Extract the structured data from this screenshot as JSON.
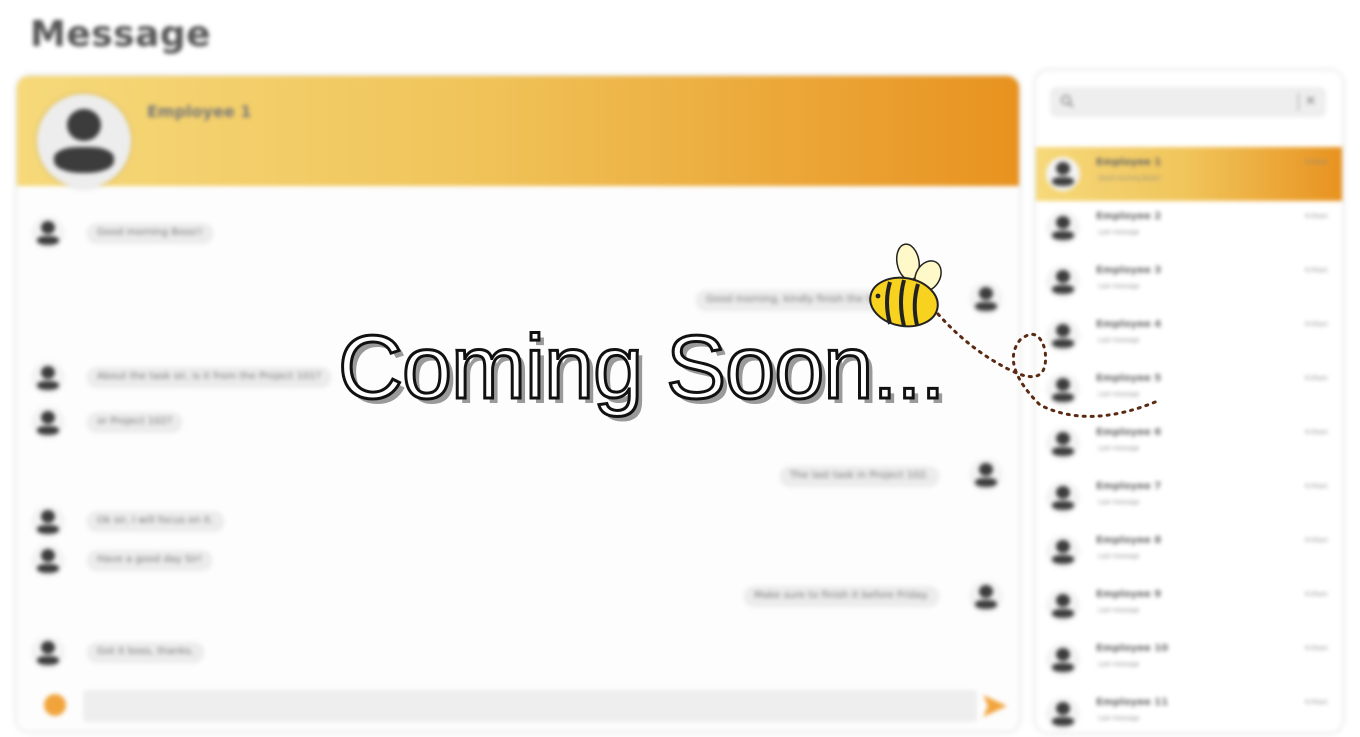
{
  "page": {
    "title": "Message"
  },
  "chat": {
    "header_name": "Employee 1",
    "messages": [
      {
        "side": "left",
        "text": "Good morning Boss!!"
      },
      {
        "side": "right",
        "text": "Good morning, kindly finish the task today"
      },
      {
        "side": "left",
        "text": "About the task sir, is it from the Project 101?"
      },
      {
        "side": "left",
        "text": "or Project 102?"
      },
      {
        "side": "right",
        "text": "The last task in Project 102."
      },
      {
        "side": "left",
        "text": "Ok sir, I will focus on it."
      },
      {
        "side": "left",
        "text": "Have a good day Sir!"
      },
      {
        "side": "right",
        "text": "Make sure to finish it before Friday."
      },
      {
        "side": "left",
        "text": "Got it boss, thanks."
      }
    ],
    "input_placeholder": ""
  },
  "contacts": {
    "search_placeholder": "",
    "clear_label": "✕",
    "items": [
      {
        "name": "Employee 1",
        "sub": "Good morning Boss!!",
        "time": "9:00am",
        "active": true
      },
      {
        "name": "Employee 2",
        "sub": "Last message",
        "time": "9:00am"
      },
      {
        "name": "Employee 3",
        "sub": "Last message",
        "time": "9:00am"
      },
      {
        "name": "Employee 4",
        "sub": "Last message",
        "time": "9:00am"
      },
      {
        "name": "Employee 5",
        "sub": "Last message",
        "time": "9:00am"
      },
      {
        "name": "Employee 6",
        "sub": "Last message",
        "time": "9:00am"
      },
      {
        "name": "Employee 7",
        "sub": "Last message",
        "time": "9:00am"
      },
      {
        "name": "Employee 8",
        "sub": "Last message",
        "time": "9:00am"
      },
      {
        "name": "Employee 9",
        "sub": "Last message",
        "time": "9:00am"
      },
      {
        "name": "Employee 10",
        "sub": "Last message",
        "time": "9:00am"
      },
      {
        "name": "Employee 11",
        "sub": "Last message",
        "time": "9:00am"
      }
    ]
  },
  "overlay": {
    "text": "Coming Soon..."
  },
  "colors": {
    "accent_light": "#f6d97a",
    "accent_dark": "#e8921f",
    "send": "#f1a43c"
  },
  "icons": [
    "user-avatar-icon",
    "search-icon",
    "close-icon",
    "emoji-icon",
    "send-icon",
    "bee-icon"
  ]
}
